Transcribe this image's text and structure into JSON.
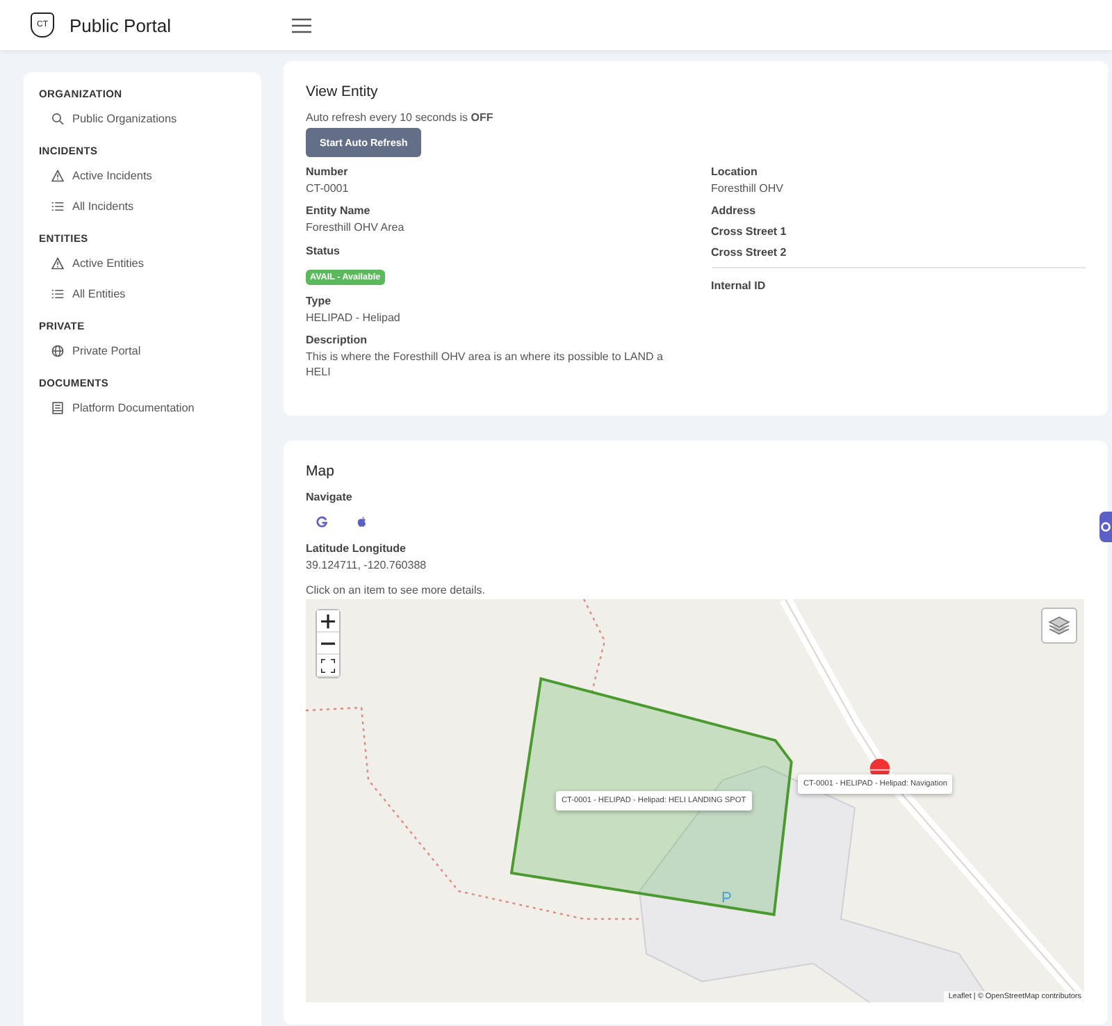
{
  "header": {
    "logo_text": "CT",
    "title": "Public Portal"
  },
  "sidebar": {
    "sections": [
      {
        "heading": "ORGANIZATION",
        "items": [
          {
            "label": "Public Organizations",
            "kind": "search"
          }
        ]
      },
      {
        "heading": "INCIDENTS",
        "items": [
          {
            "label": "Active Incidents",
            "kind": "warning"
          },
          {
            "label": "All Incidents",
            "kind": "list"
          }
        ]
      },
      {
        "heading": "ENTITIES",
        "items": [
          {
            "label": "Active Entities",
            "kind": "warning"
          },
          {
            "label": "All Entities",
            "kind": "list"
          }
        ]
      },
      {
        "heading": "PRIVATE",
        "items": [
          {
            "label": "Private Portal",
            "kind": "globe"
          }
        ]
      },
      {
        "heading": "DOCUMENTS",
        "items": [
          {
            "label": "Platform Documentation",
            "kind": "document"
          }
        ]
      }
    ]
  },
  "entity": {
    "title": "View Entity",
    "refresh_text": "Auto refresh every 10 seconds is **OFF**",
    "refresh_button": "Start Auto Refresh",
    "left_fields": [
      {
        "label": "Number",
        "value": "CT-0001"
      },
      {
        "label": "Entity Name",
        "value": "Foresthill OHV Area"
      },
      {
        "label": "Status",
        "badge": "AVAIL - Available",
        "color": "#5cb85c"
      },
      {
        "label": "Type",
        "value": "HELIPAD - Helipad"
      },
      {
        "label": "Description",
        "value": "This is where the Foresthill OHV area is an where its possible to LAND a HELI"
      }
    ],
    "right_fields": [
      {
        "label": "Location",
        "value": "Foresthill OHV",
        "divider_before": false
      },
      {
        "label": "Address",
        "divider_before": false
      },
      {
        "label": "Cross Street 1",
        "divider_before": false
      },
      {
        "label": "Cross Street 2",
        "divider_before": false
      },
      {
        "label": "Internal ID",
        "divider_before": true
      }
    ]
  },
  "map": {
    "title": "Map",
    "navigate_label": "Navigate",
    "navigate_links": [
      {
        "kind": "google"
      },
      {
        "kind": "apple"
      }
    ],
    "coords_label": "Latitude Longitude",
    "coords": "39.124711, -120.760388",
    "hint": "Click on an item to see more details.",
    "zoom_controls": [
      {
        "kind": "zoom-in"
      },
      {
        "kind": "zoom-out"
      },
      {
        "kind": "fullscreen"
      }
    ],
    "tooltips": [
      {
        "text": "CT-0001 - HELIPAD - Helipad: HELI LANDING SPOT",
        "kind": "area"
      },
      {
        "text": "CT-0001 - HELIPAD - Helipad: Navigation",
        "kind": "marker"
      }
    ],
    "attribution": "Leaflet | © OpenStreetMap contributors"
  }
}
